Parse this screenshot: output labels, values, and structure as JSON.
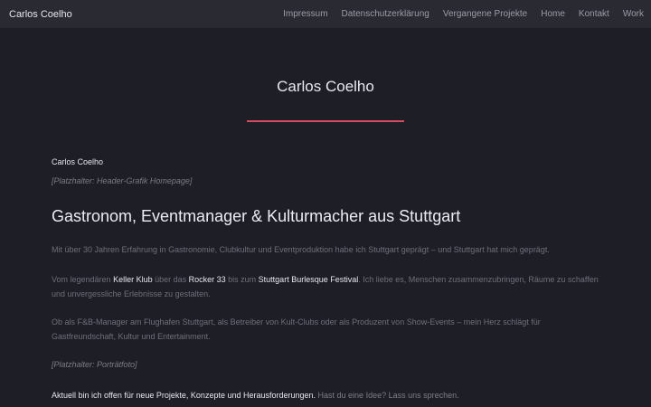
{
  "header": {
    "brand": "Carlos Coelho",
    "nav": [
      {
        "label": "Impressum"
      },
      {
        "label": "Datenschutzerklärung"
      },
      {
        "label": "Vergangene Projekte"
      },
      {
        "label": "Home"
      },
      {
        "label": "Kontakt"
      },
      {
        "label": "Work"
      }
    ]
  },
  "main": {
    "page_title": "Carlos Coelho",
    "site_name": "Carlos Coelho",
    "header_placeholder": "[Platzhalter: Header-Grafik Homepage]",
    "headline": "Gastronom, Eventmanager & Kulturmacher aus Stuttgart",
    "para1": "Mit über 30 Jahren Erfahrung in Gastronomie, Clubkultur und Eventproduktion habe ich Stuttgart geprägt – und Stuttgart hat mich geprägt.",
    "para2": {
      "t1": "Vom legendären ",
      "keller": "Keller Klub",
      "t2": " über das ",
      "rocker": "Rocker 33",
      "t3": " bis zum ",
      "festival": "Stuttgart Burlesque Festival",
      "t4": ". Ich liebe es, Menschen zusammenzubringen, Räume zu schaffen und unvergessliche Erlebnisse zu gestalten."
    },
    "para3": "Ob als F&B-Manager am Flughafen Stuttgart, als Betreiber von Kult-Clubs oder als Produzent von Show-Events – mein Herz schlägt für Gastfreundschaft, Kultur und Entertainment.",
    "portrait_placeholder": "[Platzhalter: Porträtfoto]",
    "para4": {
      "strong": "Aktuell bin ich offen für neue Projekte, Konzepte und Herausforderungen.",
      "rest": " Hast du eine Idee? Lass uns sprechen."
    }
  },
  "colors": {
    "background": "#1e1e26",
    "topbar": "#2a2a33",
    "accent_rule": "#d64a62"
  }
}
